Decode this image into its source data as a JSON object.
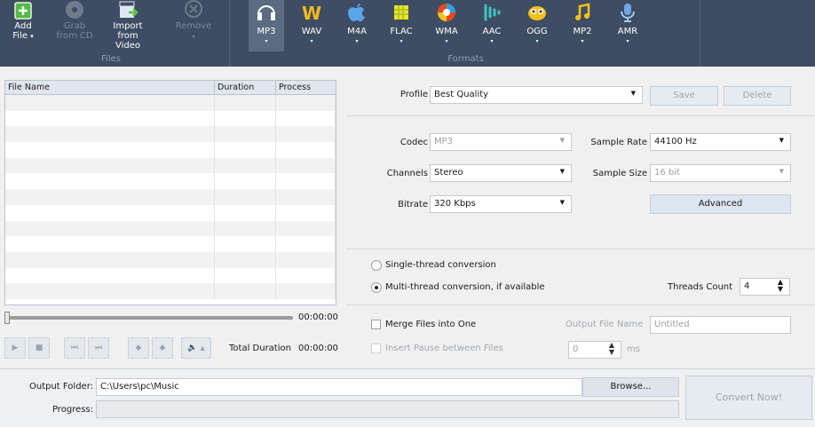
{
  "toolbar": {
    "files_group_label": "Files",
    "formats_group_label": "Formats",
    "add_file": {
      "line1": "Add",
      "line2": "File",
      "arrow": "▾"
    },
    "grab_cd": {
      "line1": "Grab",
      "line2": "from CD"
    },
    "import_video": {
      "line1": "Import",
      "line2": "from Video"
    },
    "remove": {
      "line1": "Remove",
      "arrow": "▾"
    },
    "formats": [
      {
        "label": "MP3",
        "icon": "headphones-icon",
        "selected": true
      },
      {
        "label": "WAV",
        "icon": "wav-icon"
      },
      {
        "label": "M4A",
        "icon": "apple-icon"
      },
      {
        "label": "FLAC",
        "icon": "flac-icon"
      },
      {
        "label": "WMA",
        "icon": "wma-icon"
      },
      {
        "label": "AAC",
        "icon": "aac-icon"
      },
      {
        "label": "OGG",
        "icon": "ogg-icon"
      },
      {
        "label": "MP2",
        "icon": "music-note-icon"
      },
      {
        "label": "AMR",
        "icon": "microphone-icon"
      }
    ],
    "dropdown_arrow": "▾"
  },
  "filelist": {
    "columns": [
      "File Name",
      "Duration",
      "Process"
    ]
  },
  "player": {
    "position_time": "00:00:00",
    "total_label": "Total Duration",
    "total_time": "00:00:00",
    "volume_arrow": "▲"
  },
  "profile": {
    "label": "Profile",
    "value": "Best Quality",
    "save": "Save",
    "delete": "Delete"
  },
  "settings": {
    "codec_label": "Codec",
    "codec_value": "MP3",
    "channels_label": "Channels",
    "channels_value": "Stereo",
    "bitrate_label": "Bitrate",
    "bitrate_value": "320 Kbps",
    "sample_rate_label": "Sample Rate",
    "sample_rate_value": "44100 Hz",
    "sample_size_label": "Sample Size",
    "sample_size_value": "16 bit",
    "advanced": "Advanced"
  },
  "threads": {
    "single": "Single-thread conversion",
    "multi": "Multi-thread conversion, if available",
    "count_label": "Threads Count",
    "count_value": "4"
  },
  "merge": {
    "merge_label": "Merge Files into One",
    "pause_label": "Insert Pause between Files",
    "output_name_label": "Output File Name",
    "output_name_value": "Untitled",
    "pause_value": "0",
    "pause_unit": "ms"
  },
  "bottom": {
    "output_label": "Output Folder:",
    "output_value": "C:\\Users\\pc\\Music",
    "browse": "Browse...",
    "progress_label": "Progress:",
    "convert": "Convert Now!"
  },
  "colors": {
    "toolbar_bg": "#3e4d63",
    "selected_format_bg": "#5a6b82"
  }
}
